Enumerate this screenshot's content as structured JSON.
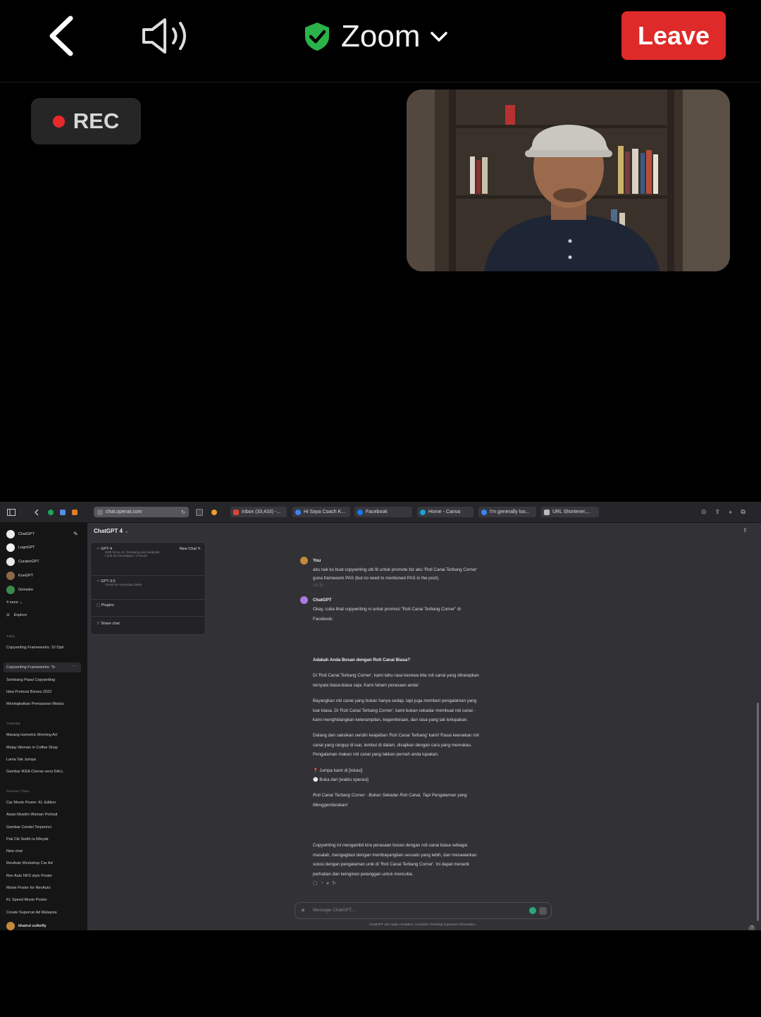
{
  "zoom": {
    "title": "Zoom",
    "leave_label": "Leave",
    "rec_label": "REC",
    "colors": {
      "leave": "#df2a2a",
      "shield": "#2bb34a",
      "rec_dot": "#e82a2a"
    }
  },
  "browser": {
    "url": "chat.openai.com",
    "tabs": [
      "Inbox (33,433) -...",
      "Hi Saya Coach K...",
      "Facebook",
      "Home - Canva",
      "I'm generally loo...",
      "URL Shortener,..."
    ]
  },
  "sidebar": {
    "gpts": [
      "ChatGPT",
      "LogoGPT",
      "CuratorGPT",
      "KoeGPT",
      "Grimoire"
    ],
    "more_label": "4 more",
    "explore_label": "Explore",
    "sections": [
      {
        "heading": "Today",
        "items": [
          "Copywriting Frameworks: 10 Opti",
          "Copywriting Frameworks: To",
          "Sembang Pasal Copywriting",
          "Idea Promosi Bisnes 2022",
          "Meningkatkan Pemasaran Melalu"
        ]
      },
      {
        "heading": "Yesterday",
        "items": [
          "Marang Isometric Morning Art",
          "Malay Woman in Coffee Shop",
          "Lama Tak Jumpa",
          "Gambar IKEA Cheras versi DALL"
        ]
      },
      {
        "heading": "Previous 7 Days",
        "items": [
          "Car Movie Poster: KL Edition",
          "Asian Muslim Woman Portrait",
          "Gambar Cendol Terperinci",
          "Pak Cik Sedih tu Minyak",
          "New chat",
          "RevAuto Workshop Car Ad",
          "Rev Auto NFS style Poster",
          "Movie Poster for RevAuto",
          "KL Speed Movie Poster",
          "Create Supercar Ad Malaysia"
        ]
      }
    ],
    "user_name": "khairul zulkefly"
  },
  "model_menu": {
    "button_label": "ChatGPT 4",
    "gpt4_label": "GPT-4",
    "gpt4_desc1": "With DALL-E, browsing and analysis",
    "gpt4_desc2": "Limit 40 messages / 3 hours",
    "new_chat_label": "New Chat",
    "gpt35_label": "GPT-3.5",
    "gpt35_desc": "Great for everyday tasks",
    "plugins_label": "Plugins",
    "share_label": "Share chat"
  },
  "conversation": {
    "user_author": "You",
    "user_msg1": "aku nak ko buat copywriting utk fb untuk promote biz aku 'Roti Canai Terbang Corner'",
    "user_msg2": "guna framework PAS (but no need to mentioned PAS in the post).",
    "pager": "‹ 2 / 2 ›",
    "bot_author": "ChatGPT",
    "bot_intro1": "Okay, cuba lihat copywriting ni untuk promosi \"Roti Canai Terbang Corner\" di",
    "bot_intro2": "Facebook:",
    "headline": "Adakah Anda Bosan dengan Roti Canai Biasa?",
    "p1a": "Di 'Roti Canai Terbang Corner', kami tahu rasa kecewa bila roti canai yang diharapkan",
    "p1b": "ternyata biasa-biasa saja. Kami faham perasaan anda!",
    "p2a": "Bayangkan roti canai yang bukan hanya sedap, tapi juga memberi pengalaman yang",
    "p2b": "luar biasa. Di 'Roti Canai Terbang Corner', kami bukan sekadar membuat roti canai -",
    "p2c": "kami menghidangkan keterampilan, kegembiraan, dan rasa yang tak terlupakan.",
    "p3a": "Datang dan saksikan sendiri keajaiban 'Roti Canai Terbang' kami! Rasai keenakan roti",
    "p3b": "canai yang rangup di luar, lembut di dalam, disajikan dengan cara yang memukau.",
    "p3c": "Pengalaman makan roti canai yang takkan pernah anda lupakan.",
    "loc": "📍 Jumpa kami di [lokasi]",
    "hours": "🕐 Buka dari [waktu operasi]",
    "tag1": "Roti Canai Terbang Corner - Bukan Sekadar Roti Canai, Tapi Pengalaman yang",
    "tag2": "Menggembirakan!",
    "c1": "Copywriting ini mengambil kira perasaan bosan dengan roti canai biasa sebagai",
    "c2": "masalah, mengagitasi dengan membayangkan sesuatu yang lebih, dan menawarkan",
    "c3": "solusi dengan pengalaman unik di 'Roti Canai Terbang Corner'. Ini dapat menarik",
    "c4": "perhatian dan keinginan pelanggan untuk mencuba.",
    "input_placeholder": "Message ChatGPT...",
    "footer": "ChatGPT can make mistakes. Consider checking important information."
  }
}
